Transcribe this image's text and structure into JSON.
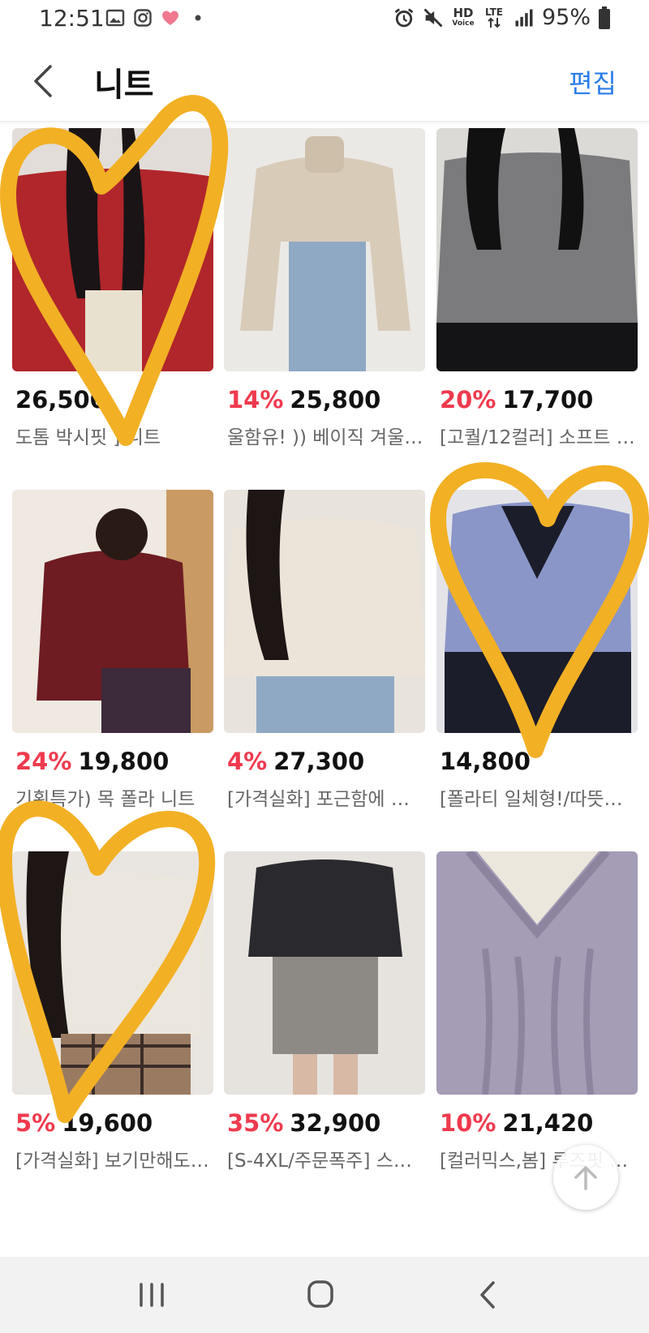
{
  "status": {
    "time": "12:51",
    "battery": "95%",
    "hd_label": "HD",
    "voice_label": "Voice",
    "lte_label": "LTE"
  },
  "header": {
    "title": "니트",
    "edit_label": "편집"
  },
  "products": [
    {
      "discount": "",
      "price": "26,500",
      "name": "도톰 박시핏 ] 니트",
      "color": "#b0262b"
    },
    {
      "discount": "14%",
      "price": "25,800",
      "name": "울함유! )) 베이직 겨울 …",
      "color": "#d8cbb8"
    },
    {
      "discount": "20%",
      "price": "17,700",
      "name": "[고퀄/12컬러] 소프트 …",
      "color": "#7b7b7e"
    },
    {
      "discount": "24%",
      "price": "19,800",
      "name": "기획특가) 목 폴라 니트",
      "color": "#6e1c22"
    },
    {
      "discount": "4%",
      "price": "27,300",
      "name": "[가격실화] 포근함에 …",
      "color": "#ece4d8"
    },
    {
      "discount": "",
      "price": "14,800",
      "name": "[폴라티 일체형!/따뜻~…",
      "color": "#8a96c8"
    },
    {
      "discount": "5%",
      "price": "19,600",
      "name": "[가격실화] 보기만해도…",
      "color": "#ece7de"
    },
    {
      "discount": "35%",
      "price": "32,900",
      "name": "[S-4XL/주문폭주] 스…",
      "color": "#2a2a2e"
    },
    {
      "discount": "10%",
      "price": "21,420",
      "name": "[컬러믹스,봄] 루즈핏 …",
      "color": "#a59cb6"
    }
  ],
  "icons": {
    "back": "chevron-left-icon",
    "scroll_top": "arrow-up-icon",
    "nav_recents": "recents-icon",
    "nav_home": "home-icon",
    "nav_back": "back-icon"
  },
  "colors": {
    "accent_blue": "#2b7de9",
    "discount_red": "#ef3a4e",
    "highlight_heart": "#f2b024"
  }
}
